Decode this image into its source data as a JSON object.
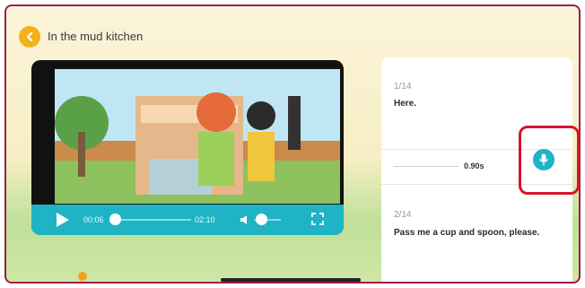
{
  "header": {
    "title": "In the mud kitchen"
  },
  "player": {
    "current_time": "00:06",
    "total_time": "02:10",
    "progress_fraction": 0.05,
    "volume_fraction": 0.25
  },
  "transcript": {
    "items": [
      {
        "counter": "1/14",
        "text": "Here."
      },
      {
        "counter": "2/14",
        "text": "Pass me a cup and spoon, please."
      }
    ],
    "recording_duration": "0.90s"
  },
  "colors": {
    "accent": "#1fb3c6",
    "back": "#f3b21b",
    "highlight": "#d8142b"
  }
}
